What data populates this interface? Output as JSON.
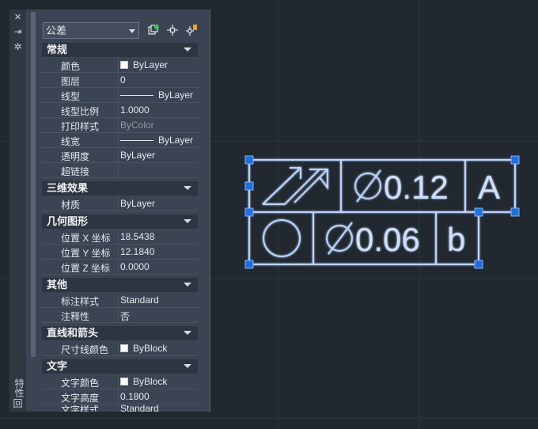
{
  "sidebar": {
    "close_icon": "×",
    "pin_icon": "⇥",
    "settings_icon": "✲",
    "vertical_label": "特性",
    "bottom_icon": "回"
  },
  "palette": {
    "type_select": "公差",
    "toolbar_icons": [
      "quick-select-icon",
      "select-objects-icon",
      "toggle-pickadd-icon"
    ],
    "sections": {
      "general": "常规",
      "3d": "三维效果",
      "geometry": "几何图形",
      "misc": "其他",
      "lines": "直线和箭头",
      "text": "文字"
    },
    "rows": {
      "color": {
        "label": "颜色",
        "value": "ByLayer"
      },
      "layer": {
        "label": "图层",
        "value": "0"
      },
      "linetype": {
        "label": "线型",
        "value": "ByLayer"
      },
      "ltscale": {
        "label": "线型比例",
        "value": "1.0000"
      },
      "plotstyle": {
        "label": "打印样式",
        "value": "ByColor"
      },
      "lineweight": {
        "label": "线宽",
        "value": "ByLayer"
      },
      "transparency": {
        "label": "透明度",
        "value": "ByLayer"
      },
      "hyperlink": {
        "label": "超链接",
        "value": ""
      },
      "material": {
        "label": "材质",
        "value": "ByLayer"
      },
      "posx": {
        "label": "位置 X 坐标",
        "value": "18.5438"
      },
      "posy": {
        "label": "位置 Y 坐标",
        "value": "12.1840"
      },
      "posz": {
        "label": "位置 Z 坐标",
        "value": "0.0000"
      },
      "dimstyle": {
        "label": "标注样式",
        "value": "Standard"
      },
      "annotative": {
        "label": "注释性",
        "value": "否"
      },
      "dimlinecolor": {
        "label": "尺寸线颜色",
        "value": "ByBlock"
      },
      "textcolor": {
        "label": "文字颜色",
        "value": "ByBlock"
      },
      "textheight": {
        "label": "文字高度",
        "value": "0.1800"
      },
      "textstyle": {
        "label": "文字样式",
        "value": "Standard"
      }
    }
  },
  "fcf": {
    "row1": {
      "tolerance": "0.12",
      "datum": "A"
    },
    "row2": {
      "tolerance": "0.06",
      "datum": "b"
    }
  },
  "colors": {
    "background": "#212830",
    "frame_line": "#bcd4ff",
    "grip": "#1f6fe0"
  }
}
